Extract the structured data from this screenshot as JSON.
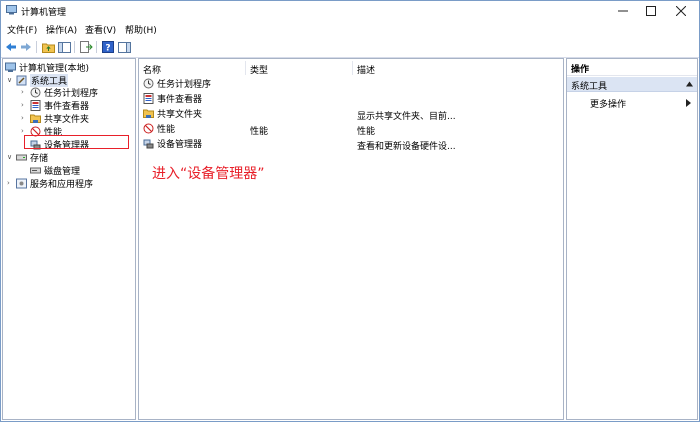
{
  "window": {
    "title": "计算机管理"
  },
  "menu": [
    "文件(F)",
    "操作(A)",
    "查看(V)",
    "帮助(H)"
  ],
  "tree": {
    "root": "计算机管理(本地)",
    "system_tools": "系统工具",
    "task_scheduler": "任务计划程序",
    "event_viewer": "事件查看器",
    "shared_folders": "共享文件夹",
    "performance": "性能",
    "device_manager": "设备管理器",
    "storage": "存储",
    "disk_management": "磁盘管理",
    "services_apps": "服务和应用程序"
  },
  "list": {
    "headers": {
      "name": "名称",
      "type": "类型",
      "desc": "描述"
    },
    "rows": [
      {
        "name": "任务计划程序",
        "type": "",
        "desc": ""
      },
      {
        "name": "事件查看器",
        "type": "",
        "desc": ""
      },
      {
        "name": "共享文件夹",
        "type": "",
        "desc": "显示共享文件夹、目前..."
      },
      {
        "name": "性能",
        "type": "性能",
        "desc": "性能"
      },
      {
        "name": "设备管理器",
        "type": "",
        "desc": "查看和更新设备硬件设..."
      }
    ]
  },
  "actions": {
    "header": "操作",
    "section": "系统工具",
    "more": "更多操作"
  },
  "annotation": "进入“设备管理器”",
  "colors": {
    "accent": "#e8202a",
    "selection": "#dbe4f3"
  }
}
